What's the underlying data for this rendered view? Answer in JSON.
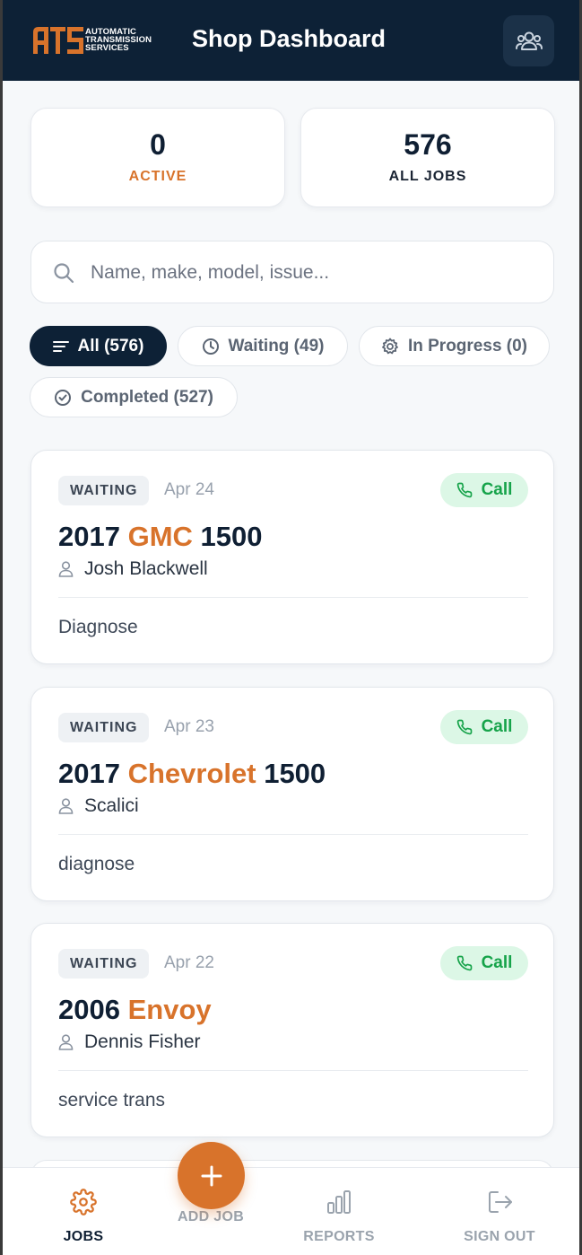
{
  "header": {
    "logo_letters": "ATS",
    "logo_line1": "AUTOMATIC",
    "logo_line2": "TRANSMISSION",
    "logo_line3": "SERVICES",
    "title": "Shop Dashboard",
    "team_icon": "users-icon"
  },
  "stats": {
    "active_count": "0",
    "active_label": "ACTIVE",
    "all_count": "576",
    "all_label": "ALL JOBS"
  },
  "search": {
    "placeholder": "Name, make, model, issue...",
    "value": ""
  },
  "filters": [
    {
      "label": "All (576)",
      "icon": "list-icon",
      "selected": true
    },
    {
      "label": "Waiting (49)",
      "icon": "clock-icon",
      "selected": false
    },
    {
      "label": "In Progress (0)",
      "icon": "gear-icon",
      "selected": false
    },
    {
      "label": "Completed (527)",
      "icon": "check-circle-icon",
      "selected": false
    }
  ],
  "jobs": [
    {
      "status": "WAITING",
      "date": "Apr 24",
      "call_label": "Call",
      "year": "2017",
      "make": "GMC",
      "model": "1500",
      "customer": "Josh Blackwell",
      "issue": "Diagnose"
    },
    {
      "status": "WAITING",
      "date": "Apr 23",
      "call_label": "Call",
      "year": "2017",
      "make": "Chevrolet",
      "model": "1500",
      "customer": "Scalici",
      "issue": "diagnose"
    },
    {
      "status": "WAITING",
      "date": "Apr 22",
      "call_label": "Call",
      "year": "2006",
      "make": "Envoy",
      "model": "",
      "customer": "Dennis Fisher",
      "issue": "service trans"
    }
  ],
  "bottom_nav": {
    "jobs": "JOBS",
    "add_job": "ADD JOB",
    "reports": "REPORTS",
    "sign_out": "SIGN OUT"
  },
  "colors": {
    "header_bg": "#0d2136",
    "accent_orange": "#d8732b",
    "call_green": "#16a34a",
    "call_bg": "#dcf7e6"
  }
}
